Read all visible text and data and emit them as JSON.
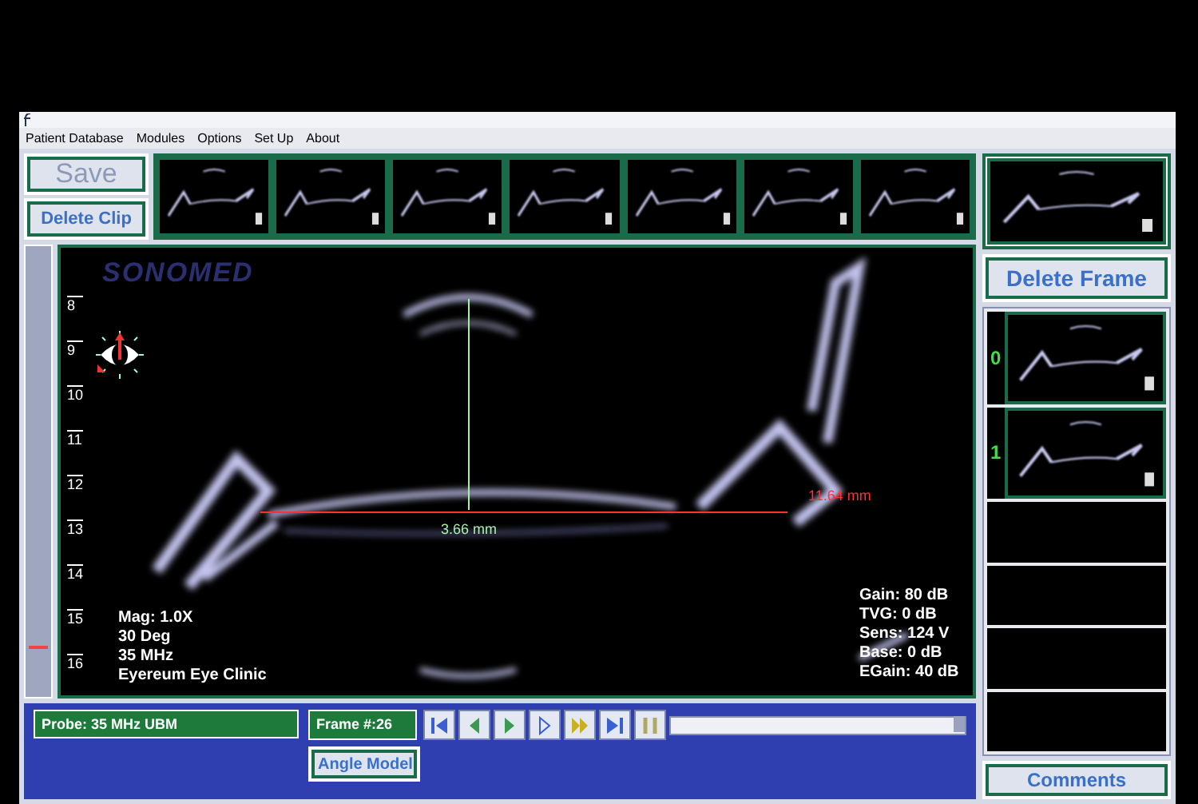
{
  "menu": [
    "Patient Database",
    "Modules",
    "Options",
    "Set Up",
    "About"
  ],
  "clip_buttons": [
    {
      "label": "Save",
      "disabled": true
    },
    {
      "label": "Delete Clip",
      "disabled": false
    }
  ],
  "delete_frame_button": "Delete Frame",
  "scan": {
    "logo": "SONOMED",
    "depth_scale": [
      "8",
      "9",
      "10",
      "11",
      "12",
      "13",
      "14",
      "15",
      "16"
    ],
    "measurements": [
      {
        "kind": "vertical",
        "label": "3.66 mm",
        "color": "#a8f0a8"
      },
      {
        "kind": "horizontal",
        "label": "11.64 mm",
        "color": "#ff3030"
      }
    ],
    "info_left": [
      "Mag: 1.0X",
      "30 Deg",
      "35 MHz",
      "Eyereum Eye Clinic"
    ],
    "info_right": [
      "Gain: 80 dB",
      "TVG: 0 dB",
      "Sens: 124 V",
      "Base: 0 dB",
      "EGain: 40 dB"
    ]
  },
  "frames": [
    {
      "label": "0"
    },
    {
      "label": "1"
    }
  ],
  "probe": "Probe: 35 MHz UBM",
  "frame_number": "Frame #:26",
  "angle_model_button": "Angle Model",
  "comments_button": "Comments"
}
